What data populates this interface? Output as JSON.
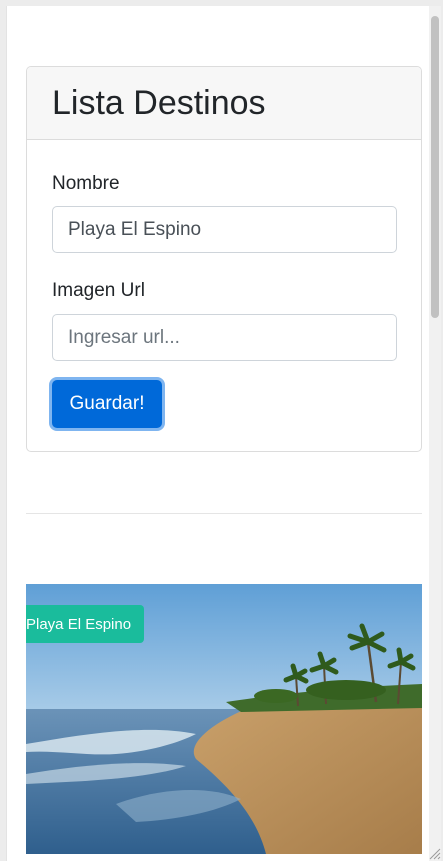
{
  "form_card": {
    "title": "Lista Destinos",
    "nombre_label": "Nombre",
    "nombre_value": "Playa El Espino",
    "imagen_label": "Imagen Url",
    "imagen_value": "",
    "imagen_placeholder": "Ingresar url...",
    "save_label": "Guardar!"
  },
  "destinations": [
    {
      "name": "Playa El Espino"
    }
  ],
  "colors": {
    "accent": "#0069d9",
    "badge": "#1abc9c"
  }
}
